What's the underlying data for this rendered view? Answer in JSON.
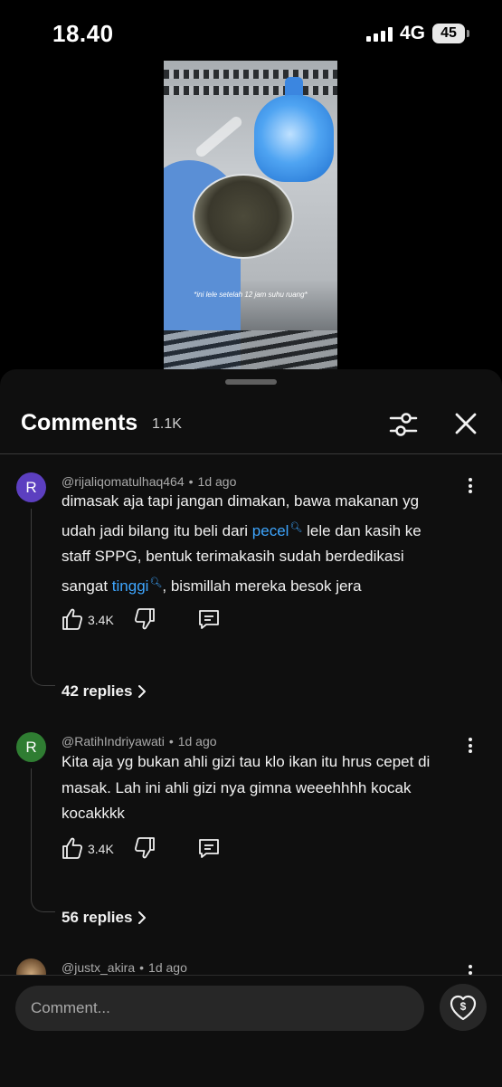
{
  "status_bar": {
    "time": "18.40",
    "network": "4G",
    "battery": "45"
  },
  "video": {
    "caption": "*ini lele setelah 12 jam suhu ruang*"
  },
  "comments_panel": {
    "title": "Comments",
    "count": "1.1K",
    "comments": [
      {
        "avatar_letter": "R",
        "avatar_color": "#5c3fc0",
        "author": "@rijaliqomatulhaq464",
        "time": "1d ago",
        "text_lines": [
          "dimasak aja tapi jangan dimakan, bawa makanan yg",
          "udah jadi bilang itu beli dari",
          "pecel",
          "lele dan kasih ke",
          "staff SPPG, bentuk terimakasih sudah berdedikasi",
          "sangat",
          "tinggi",
          ", bismillah mereka besok jera"
        ],
        "likes": "3.4K",
        "replies": "42 replies"
      },
      {
        "avatar_letter": "R",
        "avatar_color": "#2f7d32",
        "author": "@RatihIndriyawati",
        "time": "1d ago",
        "text_lines": [
          "Kita aja yg bukan ahli gizi tau klo ikan itu hrus cepet di",
          "masak. Lah ini ahli gizi nya gimna weeehhhh kocak",
          "kocakkkk"
        ],
        "likes": "3.4K",
        "replies": "56 replies"
      },
      {
        "author": "@justx_akira",
        "time": "1d ago"
      }
    ],
    "composer": {
      "placeholder": "Comment..."
    },
    "icons": {
      "filter": "sliders-icon",
      "close": "close-icon",
      "more": "more-vertical-icon",
      "like": "thumbs-up-icon",
      "dislike": "thumbs-down-icon",
      "reply": "comment-icon",
      "replies_chevron": "chevron-right-icon",
      "search_link": "search-icon",
      "thanks": "super-thanks-icon"
    },
    "accent_link_color": "#3ea6ff"
  }
}
